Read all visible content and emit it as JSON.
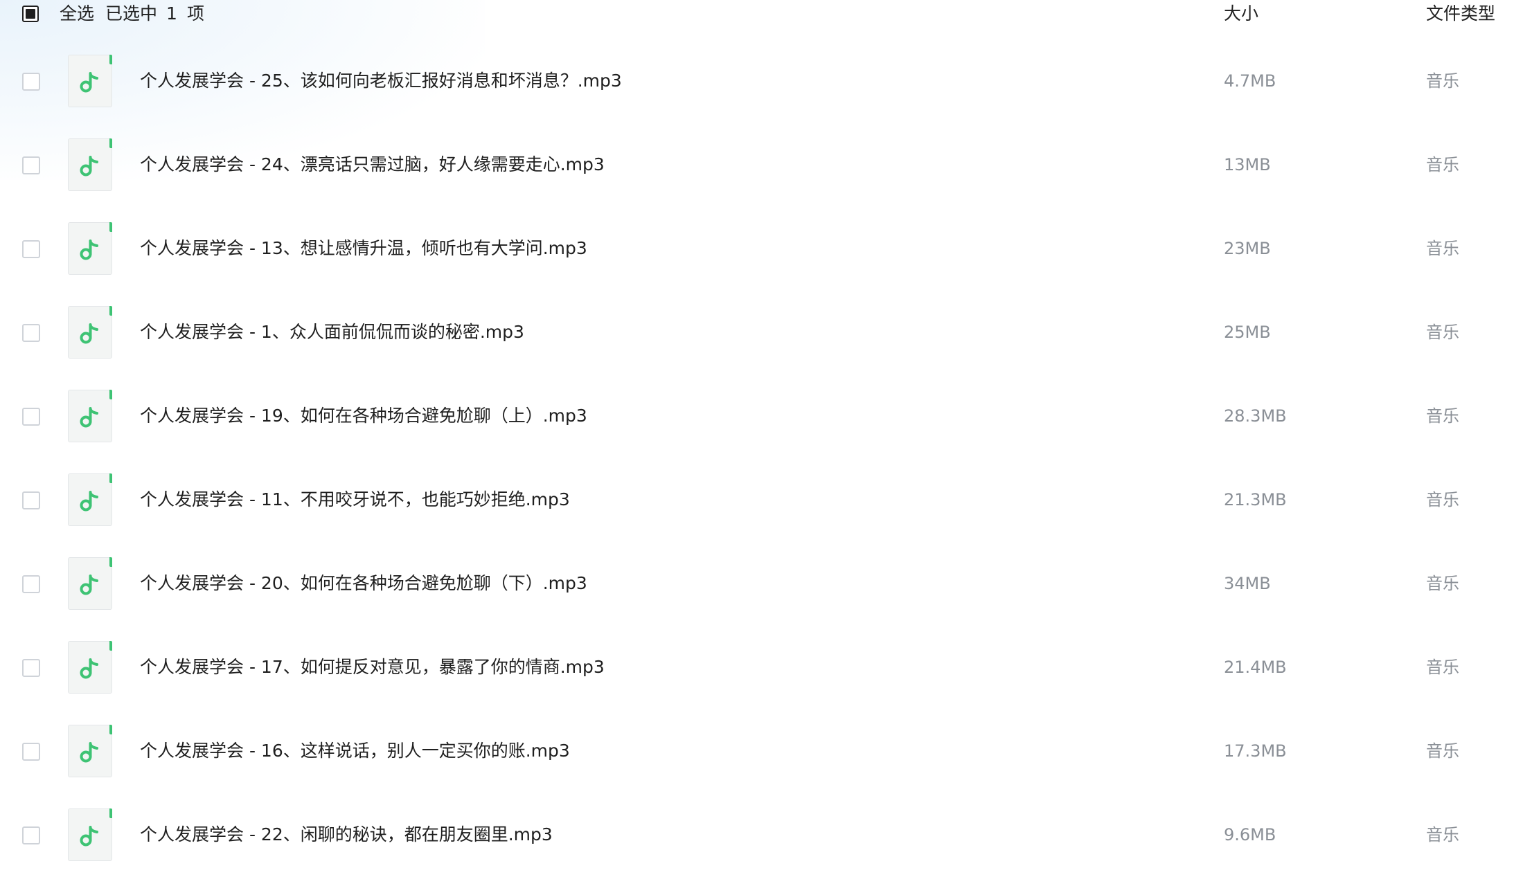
{
  "header": {
    "select_all_label": "全选",
    "selected_prefix": "已选中",
    "selected_count": "1",
    "selected_suffix": "项",
    "col_size": "大小",
    "col_type": "文件类型"
  },
  "colors": {
    "accent": "#3ec374",
    "icon_bg": "#f3f5f4"
  },
  "icon_name": "music-note-icon",
  "files": [
    {
      "name": "个人发展学会 - 25、该如何向老板汇报好消息和坏消息？.mp3",
      "size": "4.7MB",
      "type": "音乐"
    },
    {
      "name": "个人发展学会 - 24、漂亮话只需过脑，好人缘需要走心.mp3",
      "size": "13MB",
      "type": "音乐"
    },
    {
      "name": "个人发展学会 - 13、想让感情升温，倾听也有大学问.mp3",
      "size": "23MB",
      "type": "音乐"
    },
    {
      "name": "个人发展学会 - 1、众人面前侃侃而谈的秘密.mp3",
      "size": "25MB",
      "type": "音乐"
    },
    {
      "name": "个人发展学会 - 19、如何在各种场合避免尬聊（上）.mp3",
      "size": "28.3MB",
      "type": "音乐"
    },
    {
      "name": "个人发展学会 - 11、不用咬牙说不，也能巧妙拒绝.mp3",
      "size": "21.3MB",
      "type": "音乐"
    },
    {
      "name": "个人发展学会 - 20、如何在各种场合避免尬聊（下）.mp3",
      "size": "34MB",
      "type": "音乐"
    },
    {
      "name": "个人发展学会 - 17、如何提反对意见，暴露了你的情商.mp3",
      "size": "21.4MB",
      "type": "音乐"
    },
    {
      "name": "个人发展学会 - 16、这样说话，别人一定买你的账.mp3",
      "size": "17.3MB",
      "type": "音乐"
    },
    {
      "name": "个人发展学会 - 22、闲聊的秘诀，都在朋友圈里.mp3",
      "size": "9.6MB",
      "type": "音乐"
    }
  ]
}
